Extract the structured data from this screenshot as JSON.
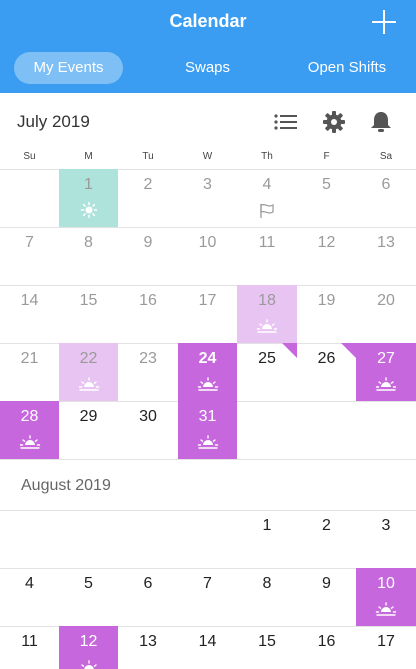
{
  "header": {
    "title": "Calendar",
    "add_icon": "plus-icon",
    "tabs": [
      {
        "label": "My Events",
        "active": true
      },
      {
        "label": "Swaps",
        "active": false
      },
      {
        "label": "Open Shifts",
        "active": false
      }
    ],
    "background_color": "#3a9df1"
  },
  "controls": {
    "list_icon": "list-icon",
    "settings_icon": "gear-icon",
    "notifications_icon": "bell-icon"
  },
  "weekdays": [
    "Su",
    "M",
    "Tu",
    "W",
    "Th",
    "F",
    "Sa"
  ],
  "colors": {
    "accent_purple": "#c667dd",
    "light_purple": "#e8c4f2",
    "teal": "#aee3dc"
  },
  "months": [
    {
      "title": "July 2019",
      "weeks": [
        [
          null,
          {
            "day": "1",
            "past": true,
            "bg": "teal",
            "icon": "sun-icon"
          },
          {
            "day": "2",
            "past": true
          },
          {
            "day": "3",
            "past": true
          },
          {
            "day": "4",
            "past": true,
            "icon": "flag-icon"
          },
          {
            "day": "5",
            "past": true
          },
          {
            "day": "6",
            "past": true
          }
        ],
        [
          {
            "day": "7",
            "past": true
          },
          {
            "day": "8",
            "past": true
          },
          {
            "day": "9",
            "past": true
          },
          {
            "day": "10",
            "past": true
          },
          {
            "day": "11",
            "past": true
          },
          {
            "day": "12",
            "past": true
          },
          {
            "day": "13",
            "past": true
          }
        ],
        [
          {
            "day": "14",
            "past": true
          },
          {
            "day": "15",
            "past": true
          },
          {
            "day": "16",
            "past": true
          },
          {
            "day": "17",
            "past": true
          },
          {
            "day": "18",
            "past": true,
            "bg": "lilac",
            "icon": "sunrise-icon"
          },
          {
            "day": "19",
            "past": true
          },
          {
            "day": "20",
            "past": true
          }
        ],
        [
          {
            "day": "21",
            "past": true
          },
          {
            "day": "22",
            "past": true,
            "bg": "lilac",
            "icon": "sunrise-icon"
          },
          {
            "day": "23",
            "past": true
          },
          {
            "day": "24",
            "today": true,
            "bold": true,
            "bg": "purple",
            "icon": "sunrise-icon"
          },
          {
            "day": "25",
            "corner": true
          },
          {
            "day": "26",
            "corner": true
          },
          {
            "day": "27",
            "bg": "purple",
            "icon": "sunrise-icon"
          }
        ],
        [
          {
            "day": "28",
            "bg": "purple",
            "icon": "sunrise-icon"
          },
          {
            "day": "29"
          },
          {
            "day": "30"
          },
          {
            "day": "31",
            "bg": "purple",
            "icon": "sunrise-icon"
          },
          null,
          null,
          null
        ]
      ]
    },
    {
      "title": "August 2019",
      "weeks": [
        [
          null,
          null,
          null,
          null,
          {
            "day": "1"
          },
          {
            "day": "2"
          },
          {
            "day": "3"
          }
        ],
        [
          {
            "day": "4"
          },
          {
            "day": "5"
          },
          {
            "day": "6"
          },
          {
            "day": "7"
          },
          {
            "day": "8"
          },
          {
            "day": "9"
          },
          {
            "day": "10",
            "bg": "purple",
            "icon": "sunrise-icon"
          }
        ],
        [
          {
            "day": "11"
          },
          {
            "day": "12",
            "bg": "purple",
            "icon": "sunrise-icon"
          },
          {
            "day": "13"
          },
          {
            "day": "14"
          },
          {
            "day": "15"
          },
          {
            "day": "16"
          },
          {
            "day": "17"
          }
        ]
      ]
    }
  ]
}
